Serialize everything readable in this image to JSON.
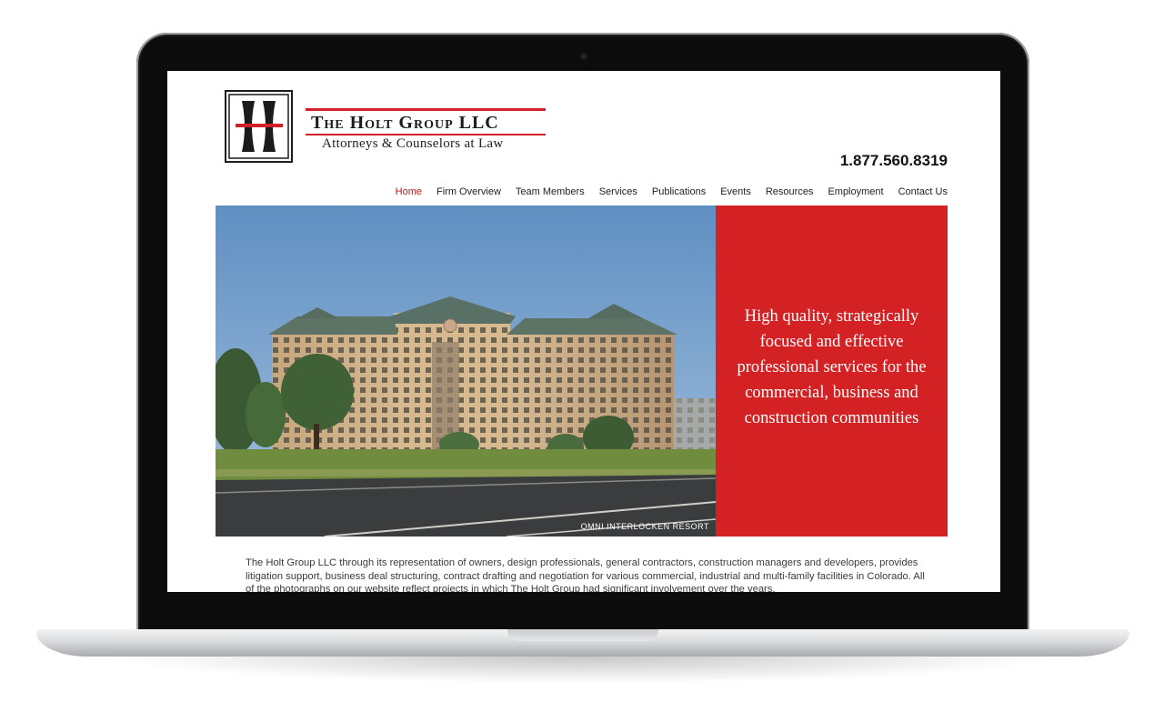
{
  "site": {
    "logo_name": "The Holt Group LLC",
    "logo_tagline": "Attorneys & Counselors at Law",
    "phone": "1.877.560.8319"
  },
  "nav": {
    "items": [
      {
        "label": "Home",
        "active": true
      },
      {
        "label": "Firm Overview"
      },
      {
        "label": "Team Members"
      },
      {
        "label": "Services"
      },
      {
        "label": "Publications"
      },
      {
        "label": "Events"
      },
      {
        "label": "Resources"
      },
      {
        "label": "Employment"
      },
      {
        "label": "Contact Us"
      }
    ]
  },
  "hero": {
    "caption": "OMNI INTERLOCKEN RESORT",
    "tagline": "High quality, strategically focused and effective professional services for the commercial, business and construction communities"
  },
  "intro": {
    "text": "The Holt Group LLC through its representation of owners, design professionals, general contractors, construction managers and developers, provides litigation support, business deal structuring, contract drafting and negotiation for various commercial, industrial and multi-family facilities in Colorado. All of the photographs on our website reflect projects in which The Holt Group had significant involvement over the years."
  },
  "colors": {
    "brand_red": "#d32124",
    "nav_active": "#b2181c",
    "text_dark": "#1b1b1b"
  },
  "icons": {
    "logo": "h-monogram-logo",
    "camera": "webcam-dot"
  }
}
